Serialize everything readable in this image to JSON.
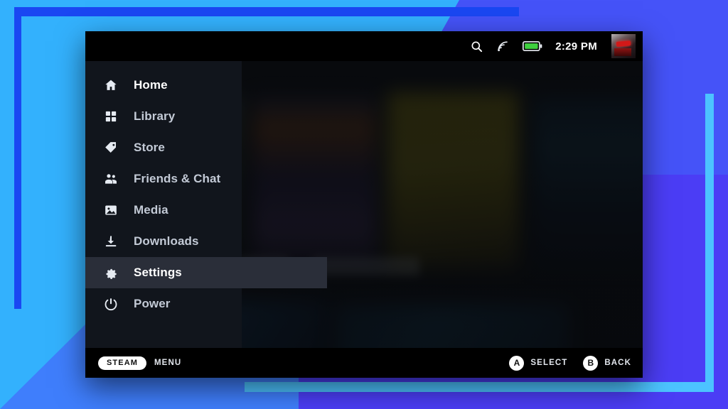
{
  "decor": {
    "bg_light_blue": "#33b1fd",
    "bg_blue": "#4553f8",
    "bg_violet": "#4b3df5",
    "frame_dark_blue": "#1a47f2",
    "frame_light_blue": "#4cc3ff"
  },
  "statusbar": {
    "search_icon": "search-icon",
    "network_icon": "wifi-signal-icon",
    "battery_icon": "battery-full-icon",
    "battery_color": "#3fd13f",
    "time": "2:29 PM",
    "avatar": "user-avatar"
  },
  "sidebar": {
    "items": [
      {
        "label": "Home",
        "icon": "home-icon",
        "active": false,
        "first": true
      },
      {
        "label": "Library",
        "icon": "grid-icon",
        "active": false,
        "first": false
      },
      {
        "label": "Store",
        "icon": "tag-icon",
        "active": false,
        "first": false
      },
      {
        "label": "Friends & Chat",
        "icon": "people-icon",
        "active": false,
        "first": false
      },
      {
        "label": "Media",
        "icon": "image-icon",
        "active": false,
        "first": false
      },
      {
        "label": "Downloads",
        "icon": "download-icon",
        "active": false,
        "first": false
      },
      {
        "label": "Settings",
        "icon": "gear-icon",
        "active": true,
        "first": false
      },
      {
        "label": "Power",
        "icon": "power-icon",
        "active": false,
        "first": false
      }
    ],
    "active_index": 6
  },
  "bottombar": {
    "steam_pill": "STEAM",
    "menu_label": "MENU",
    "hints": [
      {
        "button": "A",
        "label": "SELECT"
      },
      {
        "button": "B",
        "label": "BACK"
      }
    ]
  },
  "background_content": {
    "description": "blurred Steam game library grid behind the menu overlay"
  }
}
